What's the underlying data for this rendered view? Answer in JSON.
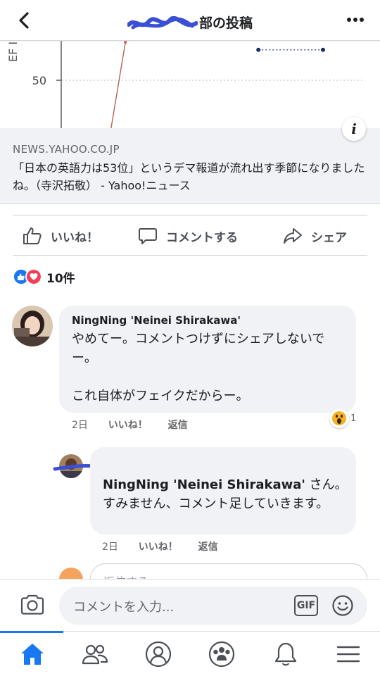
{
  "header": {
    "title_suffix": "部の投稿"
  },
  "chart_data": {
    "type": "line",
    "ylabel": "EF I",
    "tick_label": "50",
    "series": [
      {
        "name": "",
        "color": "#b7614f",
        "x": [
          0.29,
          0.33
        ],
        "values": [
          43,
          55
        ]
      },
      {
        "name": "",
        "color": "#1a2a6c",
        "x": [
          0.68,
          0.85
        ],
        "values": [
          54,
          54
        ]
      }
    ]
  },
  "link_preview": {
    "domain": "NEWS.YAHOO.CO.JP",
    "title": "「日本の英語力は53位」というデマ報道が流れ出す季節になりましたね。（寺沢拓敬） - Yahoo!ニュース"
  },
  "info_icon": "i",
  "actions": {
    "like": "いいね！",
    "comment": "コメントする",
    "share": "シェア"
  },
  "reactions": {
    "count": "10件"
  },
  "comments": [
    {
      "author": "NingNing 'Neinei Shirakawa'",
      "text": "やめてー。コメントつけずにシェアしないでー。\n\nこれ自体がフェイクだからー。",
      "time": "2日",
      "like": "いいね！",
      "reply": "返信",
      "reaction_count": "1"
    },
    {
      "author": "",
      "mention": "NingNing 'Neinei Shirakawa'",
      "text_after_mention": " さん。すみません、コメント足していきます。",
      "time": "2日",
      "like": "いいね！",
      "reply": "返信"
    }
  ],
  "reply_input": {
    "placeholder": "返信する..."
  },
  "comment_input": {
    "placeholder": "コメントを入力...",
    "gif_label": "GIF"
  },
  "nav": [
    "home-icon",
    "friends-icon",
    "profile-icon",
    "groups-icon",
    "notifications-icon",
    "menu-icon"
  ],
  "colors": {
    "accent": "#1877f2",
    "bubble": "#f0f2f5",
    "redaction": "#3a4fd6"
  }
}
